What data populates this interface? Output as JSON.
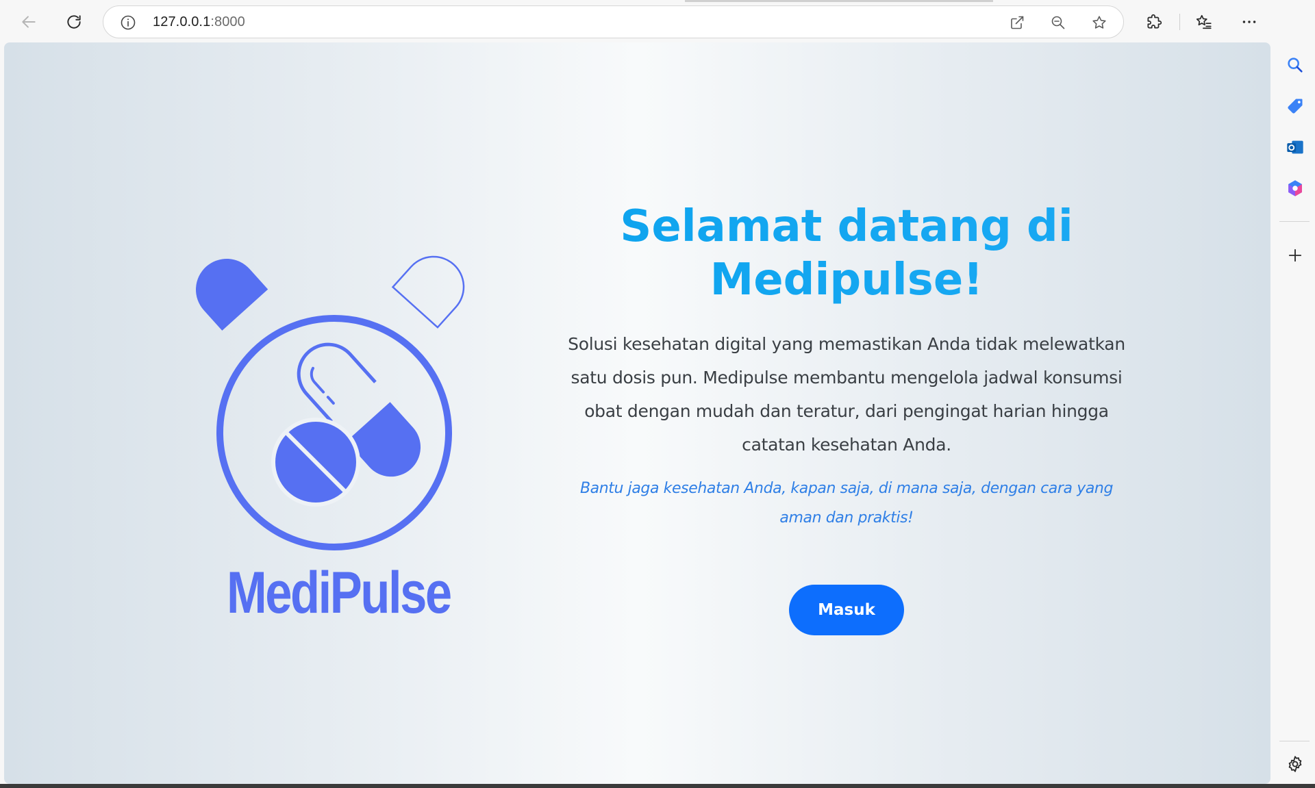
{
  "browser": {
    "address": {
      "host": "127.0.0.1",
      "port": ":8000"
    },
    "icons": {
      "back": "back-arrow-icon",
      "refresh": "refresh-icon",
      "site_info": "info-icon",
      "open_in_app": "open-external-icon",
      "zoom": "zoom-out-icon",
      "favorite": "star-icon",
      "extensions": "puzzle-icon",
      "favorites": "favorites-list-icon",
      "more": "more-dots-icon",
      "copilot": "copilot-icon"
    }
  },
  "sidepanel": {
    "icons": [
      "search-icon",
      "shopping-tag-icon",
      "outlook-icon",
      "microsoft365-icon",
      "add-icon",
      "settings-icon"
    ]
  },
  "brand": {
    "name": "MediPulse",
    "color": "#5670f2"
  },
  "hero": {
    "title": "Selamat datang di Medipulse!",
    "description": "Solusi kesehatan digital yang memastikan Anda tidak melewatkan satu dosis pun. Medipulse membantu mengelola jadwal konsumsi obat dengan mudah dan teratur, dari pengingat harian hingga catatan kesehatan Anda.",
    "tagline": "Bantu jaga kesehatan Anda, kapan saja, di mana saja, dengan cara yang aman dan praktis!",
    "button_label": "Masuk",
    "title_color": "#12a6ee",
    "button_color": "#0d6efd"
  }
}
